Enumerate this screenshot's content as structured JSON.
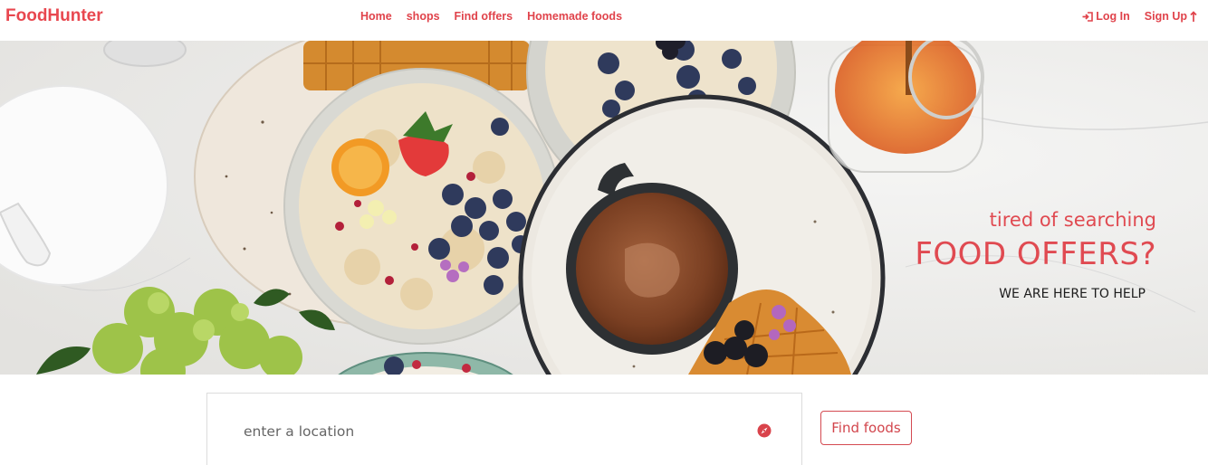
{
  "brand": {
    "name": "FoodHunter"
  },
  "nav": {
    "links": [
      {
        "label": "Home"
      },
      {
        "label": "shops"
      },
      {
        "label": "Find offers"
      },
      {
        "label": "Homemade foods"
      }
    ],
    "login_label": "Log In",
    "signup_label": "Sign Up"
  },
  "hero": {
    "tagline": "tired of searching",
    "headline": "FOOD OFFERS?",
    "subline": "WE ARE HERE TO HELP",
    "image_subject": "breakfast table with oatmeal bowls, berries, coffee mug, waffles and honey jar"
  },
  "search": {
    "placeholder": "enter a location",
    "value": "",
    "locate_icon": "compass-icon",
    "button_label": "Find foods"
  },
  "colors": {
    "accent": "#e8474f",
    "text_dark": "#1c1c1c",
    "background": "#ffffff"
  }
}
